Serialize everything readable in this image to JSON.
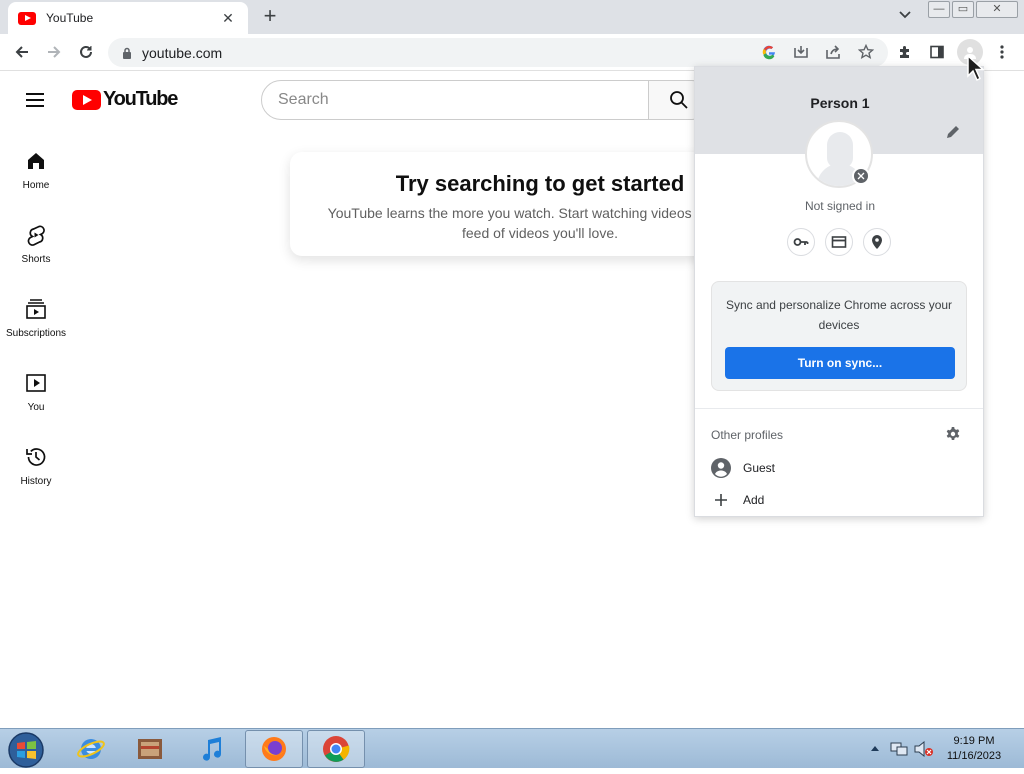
{
  "browser": {
    "tab_title": "YouTube",
    "tab_close": "✕",
    "new_tab": "+",
    "url": "youtube.com",
    "window_controls": [
      "—",
      "▭",
      "✕"
    ],
    "icons": [
      "back-icon",
      "forward-icon",
      "reload-icon",
      "lock-icon",
      "google-icon",
      "install-icon",
      "share-icon",
      "star-icon",
      "extensions-icon",
      "side-panel-icon",
      "profile-icon",
      "menu-icon"
    ]
  },
  "youtube": {
    "logo_text": "YouTube",
    "search_placeholder": "Search",
    "sidebar": [
      {
        "label": "Home",
        "icon": "home-icon"
      },
      {
        "label": "Shorts",
        "icon": "shorts-icon"
      },
      {
        "label": "Subscriptions",
        "icon": "subscriptions-icon"
      },
      {
        "label": "You",
        "icon": "you-icon"
      },
      {
        "label": "History",
        "icon": "history-icon"
      }
    ],
    "prompt_title": "Try searching to get started",
    "prompt_text": "YouTube learns the more you watch. Start watching videos to build a feed of videos you'll love."
  },
  "profile_menu": {
    "name": "Person 1",
    "status": "Not signed in",
    "quick_icons": [
      "key-icon",
      "card-icon",
      "location-icon"
    ],
    "sync_text": "Sync and personalize Chrome across your devices",
    "sync_button": "Turn on sync...",
    "other_profiles_label": "Other profiles",
    "profiles": [
      {
        "label": "Guest",
        "icon": "guest-icon"
      },
      {
        "label": "Add",
        "icon": "add-icon"
      }
    ]
  },
  "taskbar": {
    "time": "9:19 PM",
    "date": "11/16/2023",
    "apps": [
      "internet-explorer-icon",
      "media-center-icon",
      "itunes-icon",
      "firefox-icon",
      "chrome-icon"
    ]
  },
  "colors": {
    "brand_red": "#ff0000",
    "sync_blue": "#1a73e8",
    "tabstrip": "#dee1e6"
  }
}
